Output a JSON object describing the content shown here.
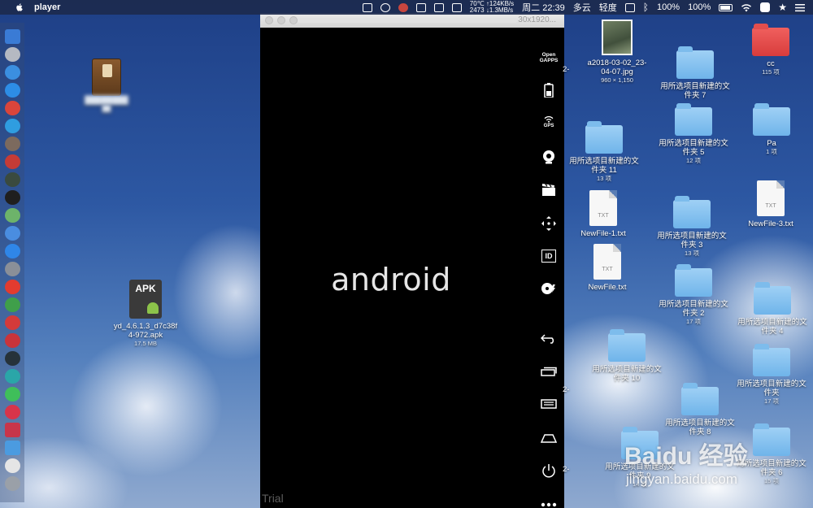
{
  "menubar": {
    "app_name": "player",
    "temp": "70℃",
    "net_up": "↑124KB/s",
    "cpu": "2473",
    "net_down": "↓1.3MB/s",
    "clock": "周二 22:39",
    "weather": "多云",
    "weather2": "轻度",
    "bluetooth": "ᛒ",
    "volume": "100%",
    "battery": "100%"
  },
  "emulator": {
    "title": "30x1920...",
    "boot_logo": "android",
    "trial_label": "Trial",
    "sidebar": {
      "gapps_line1": "Open",
      "gapps_line2": "GAPPS",
      "gps_label": "GPS",
      "id_label": "ID"
    }
  },
  "desktop": {
    "apk_badge": "APK",
    "apk_name_line1": "yd_4.6.1.3_d7c38f",
    "apk_name_line2": "4-972.apk",
    "apk_size": "17.5 MB",
    "blurred_item_line1": "████████",
    "blurred_item_line2": "██",
    "image_file": "a2018-03-02_23-",
    "image_file_line2": "04-07.jpg",
    "image_dims": "960 × 1,150",
    "folder_7_line1": "用所选项目新建的文",
    "folder_7_line2": "件夹 7",
    "cc_name": "cc",
    "cc_count": "115 项",
    "folder_11_line1": "用所选项目新建的文",
    "folder_11_line2": "件夹 11",
    "folder_11_count": "13 项",
    "folder_5_line1": "用所选项目新建的文",
    "folder_5_line2": "件夹 5",
    "folder_5_count": "12 项",
    "pa_name": "Pa",
    "pa_count": "1 项",
    "newfile1": "NewFile-1.txt",
    "folder_3_line1": "用所选项目新建的文",
    "folder_3_line2": "件夹 3",
    "folder_3_count": "13 项",
    "newfile3": "NewFile-3.txt",
    "newfile": "NewFile.txt",
    "folder_2_line1": "用所选项目新建的文",
    "folder_2_line2": "件夹 2",
    "folder_2_count": "17 项",
    "folder_4_line1": "用所选项目新建的文",
    "folder_4_line2": "件夹 4",
    "folder_10_line1": "用所选项目新建的文",
    "folder_10_line2": "件夹 10",
    "folder_plain_line1": "用所选项目新建的文",
    "folder_plain_line2": "件夹",
    "folder_plain_count": "17 项",
    "folder_8_line1": "用所选项目新建的文",
    "folder_8_line2": "件夹 8",
    "folder_9_line1": "用所选项目新建的文",
    "folder_9_line2": "件夹 9",
    "folder_9_count": "14 项",
    "folder_6_line1": "用所选项目新建的文",
    "folder_6_line2": "件夹 6",
    "folder_6_count": "15 项",
    "txt_ext": "TXT",
    "edge_label": "2-"
  },
  "watermark": {
    "logo": "Baidu 经验",
    "url": "jingyan.baidu.com"
  },
  "colors": {
    "dock_icons": [
      "#3a7bd5",
      "#b5b9c2",
      "#3b8fe0",
      "#2d8de6",
      "#d9453b",
      "#2f9de0",
      "#7c6a5e",
      "#c53b36",
      "#3a4a3f",
      "#1f1f1f",
      "#6db36a",
      "#4a8de0",
      "#2f86e8",
      "#8a8f98",
      "#e33b2f",
      "#3f9f4a",
      "#d43a3a",
      "#c9343b",
      "#26323a",
      "#2aa6a8",
      "#3fbf5a",
      "#d8344a",
      "#c8354a",
      "#4b9be0",
      "#e5e5e5",
      "#9aa0a8"
    ],
    "folder": "#7dbcec",
    "folder_red": "#e24e4d"
  }
}
